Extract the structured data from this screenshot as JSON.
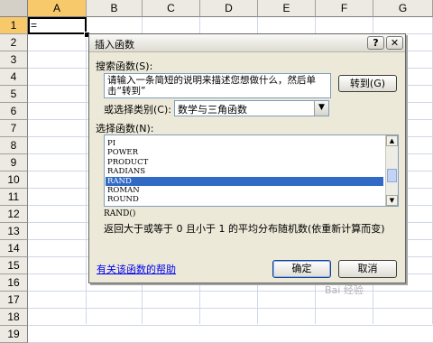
{
  "sheet": {
    "columns": [
      "A",
      "B",
      "C",
      "D",
      "E",
      "F",
      "G"
    ],
    "rows": [
      "1",
      "2",
      "3",
      "4",
      "5",
      "6",
      "7",
      "8",
      "9",
      "10",
      "11",
      "12",
      "13",
      "14",
      "15",
      "16",
      "17",
      "18",
      "19"
    ],
    "active_cell_value": "="
  },
  "dialog": {
    "title": "插入函数",
    "help_button": "?",
    "close_button": "✕",
    "search_label": "搜索函数(S):",
    "search_text": "请输入一条简短的说明来描述您想做什么，然后单击“转到”",
    "goto_button": "转到(G)",
    "category_label": "或选择类别(C):",
    "category_value": "数学与三角函数",
    "select_label": "选择函数(N):",
    "functions": [
      "PI",
      "POWER",
      "PRODUCT",
      "RADIANS",
      "RAND",
      "ROMAN",
      "ROUND"
    ],
    "selected_function": "RAND",
    "signature": "RAND()",
    "description": "返回大于或等于 0 且小于 1 的平均分布随机数(依重新计算而变)",
    "help_link": "有关该函数的帮助",
    "ok_button": "确定",
    "cancel_button": "取消"
  },
  "watermark": "Bai 经验"
}
